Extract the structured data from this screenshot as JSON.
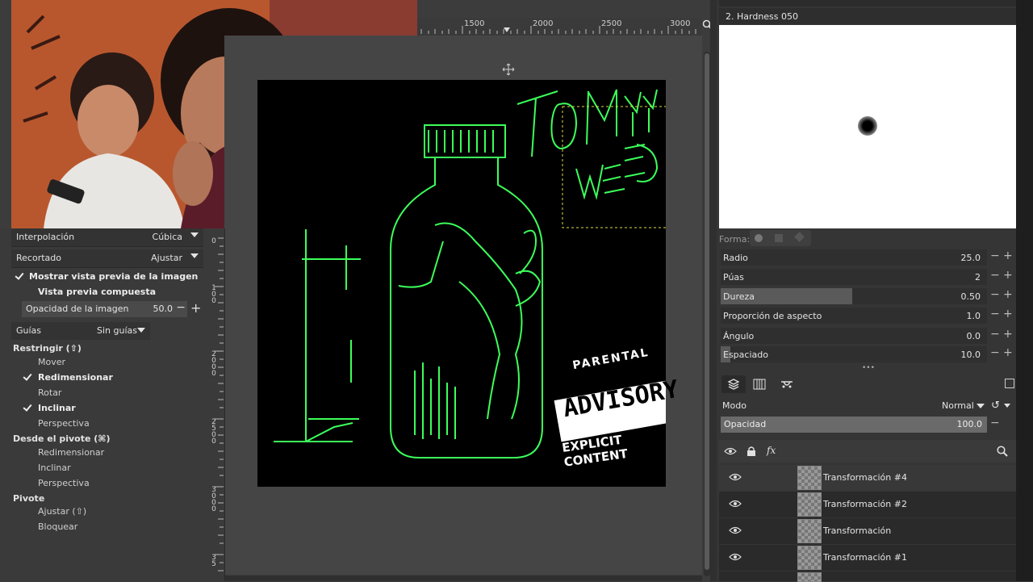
{
  "canvas": {
    "top_ruler_labels": [
      "1500",
      "2000",
      "2500",
      "3000"
    ],
    "artwork": {
      "title_line1": "TOMMY",
      "title_line2": "WEED",
      "advisory_top": "PARENTAL",
      "advisory_main": "ADVISORY",
      "advisory_bottom": "EXPLICIT CONTENT",
      "accent_color": "#3cff5a"
    }
  },
  "tool_options": {
    "interpolation": {
      "label": "Interpolación",
      "value": "Cúbica"
    },
    "clipping": {
      "label": "Recortado",
      "value": "Ajustar"
    },
    "show_preview": {
      "label": "Mostrar vista previa de la imagen",
      "checked": true
    },
    "composite_preview": {
      "label": "Vista previa compuesta",
      "checked": false
    },
    "image_opacity": {
      "label": "Opacidad de la imagen",
      "value": "50.0"
    },
    "guides": {
      "label": "Guías",
      "value": "Sin guías"
    },
    "constrain": {
      "title": "Restringir (⇧)",
      "items": [
        {
          "label": "Mover",
          "checked": false
        },
        {
          "label": "Redimensionar",
          "checked": true
        },
        {
          "label": "Rotar",
          "checked": false
        },
        {
          "label": "Inclinar",
          "checked": true
        },
        {
          "label": "Perspectiva",
          "checked": false
        }
      ]
    },
    "from_pivot": {
      "title": "Desde el pivote (⌘)",
      "items": [
        {
          "label": "Redimensionar",
          "checked": false
        },
        {
          "label": "Inclinar",
          "checked": false
        },
        {
          "label": "Perspectiva",
          "checked": false
        }
      ]
    },
    "pivot": {
      "title": "Pivote",
      "items": [
        {
          "label": "Ajustar (⇧)",
          "checked": false
        },
        {
          "label": "Bloquear",
          "checked": false
        }
      ]
    }
  },
  "vertical_ruler_labels": [
    [
      "0"
    ],
    [
      "1",
      "0",
      "0"
    ],
    [
      "2",
      "0",
      "0",
      "0"
    ],
    [
      "2",
      "5",
      "0",
      "0"
    ],
    [
      "3",
      "0",
      "0",
      "0"
    ],
    [
      "3",
      "5"
    ]
  ],
  "brushes": {
    "title": "2. Hardness 050",
    "shape_label": "Forma:",
    "sliders": [
      {
        "label": "Radio",
        "value": "25.0",
        "fill": 0
      },
      {
        "label": "Púas",
        "value": "2",
        "fill": 0
      },
      {
        "label": "Dureza",
        "value": "0.50",
        "fill": 0.5
      },
      {
        "label": "Proporción de aspecto",
        "value": "1.0",
        "fill": 0
      },
      {
        "label": "Ángulo",
        "value": "0.0",
        "fill": 0
      },
      {
        "label": "Espaciado",
        "value": "10.0",
        "fill": 0
      }
    ]
  },
  "layers": {
    "mode_label": "Modo",
    "mode_value": "Normal",
    "opacity_label": "Opacidad",
    "opacity_value": "100.0",
    "items": [
      {
        "name": "Transformación #4",
        "selected": true
      },
      {
        "name": "Transformación #2",
        "selected": false
      },
      {
        "name": "Transformación",
        "selected": false
      },
      {
        "name": "Transformación #1",
        "selected": false
      }
    ]
  }
}
